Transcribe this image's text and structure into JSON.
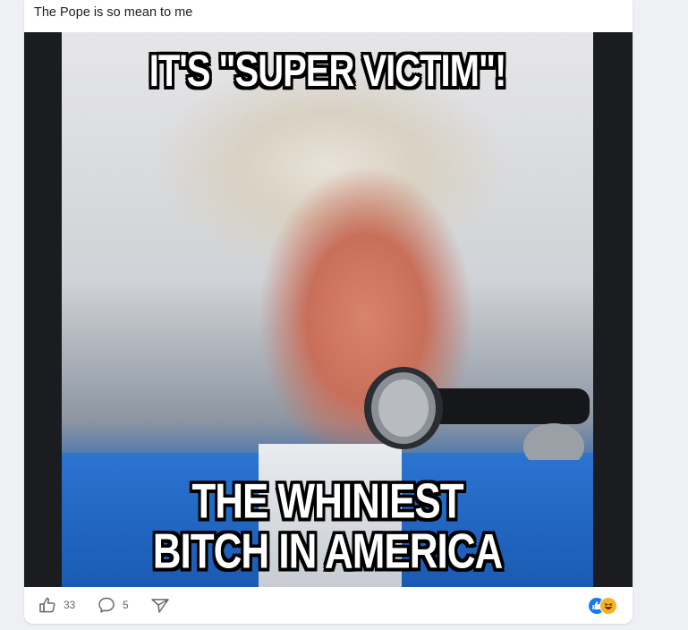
{
  "post": {
    "caption": "The Pope is so mean to me"
  },
  "meme": {
    "top_text": "IT'S \"SUPER VICTIM\"!",
    "bottom_line1": "THE WHINIEST",
    "bottom_line2": "BITCH IN AMERICA"
  },
  "actions": {
    "like_count": "33",
    "comment_count": "5"
  },
  "reactions": [
    "like",
    "haha"
  ],
  "colors": {
    "card_bg": "#ffffff",
    "page_bg": "#eef0f3",
    "action_gray": "#65676b",
    "like_blue": "#1877f2",
    "haha_yellow": "#f7b125"
  }
}
